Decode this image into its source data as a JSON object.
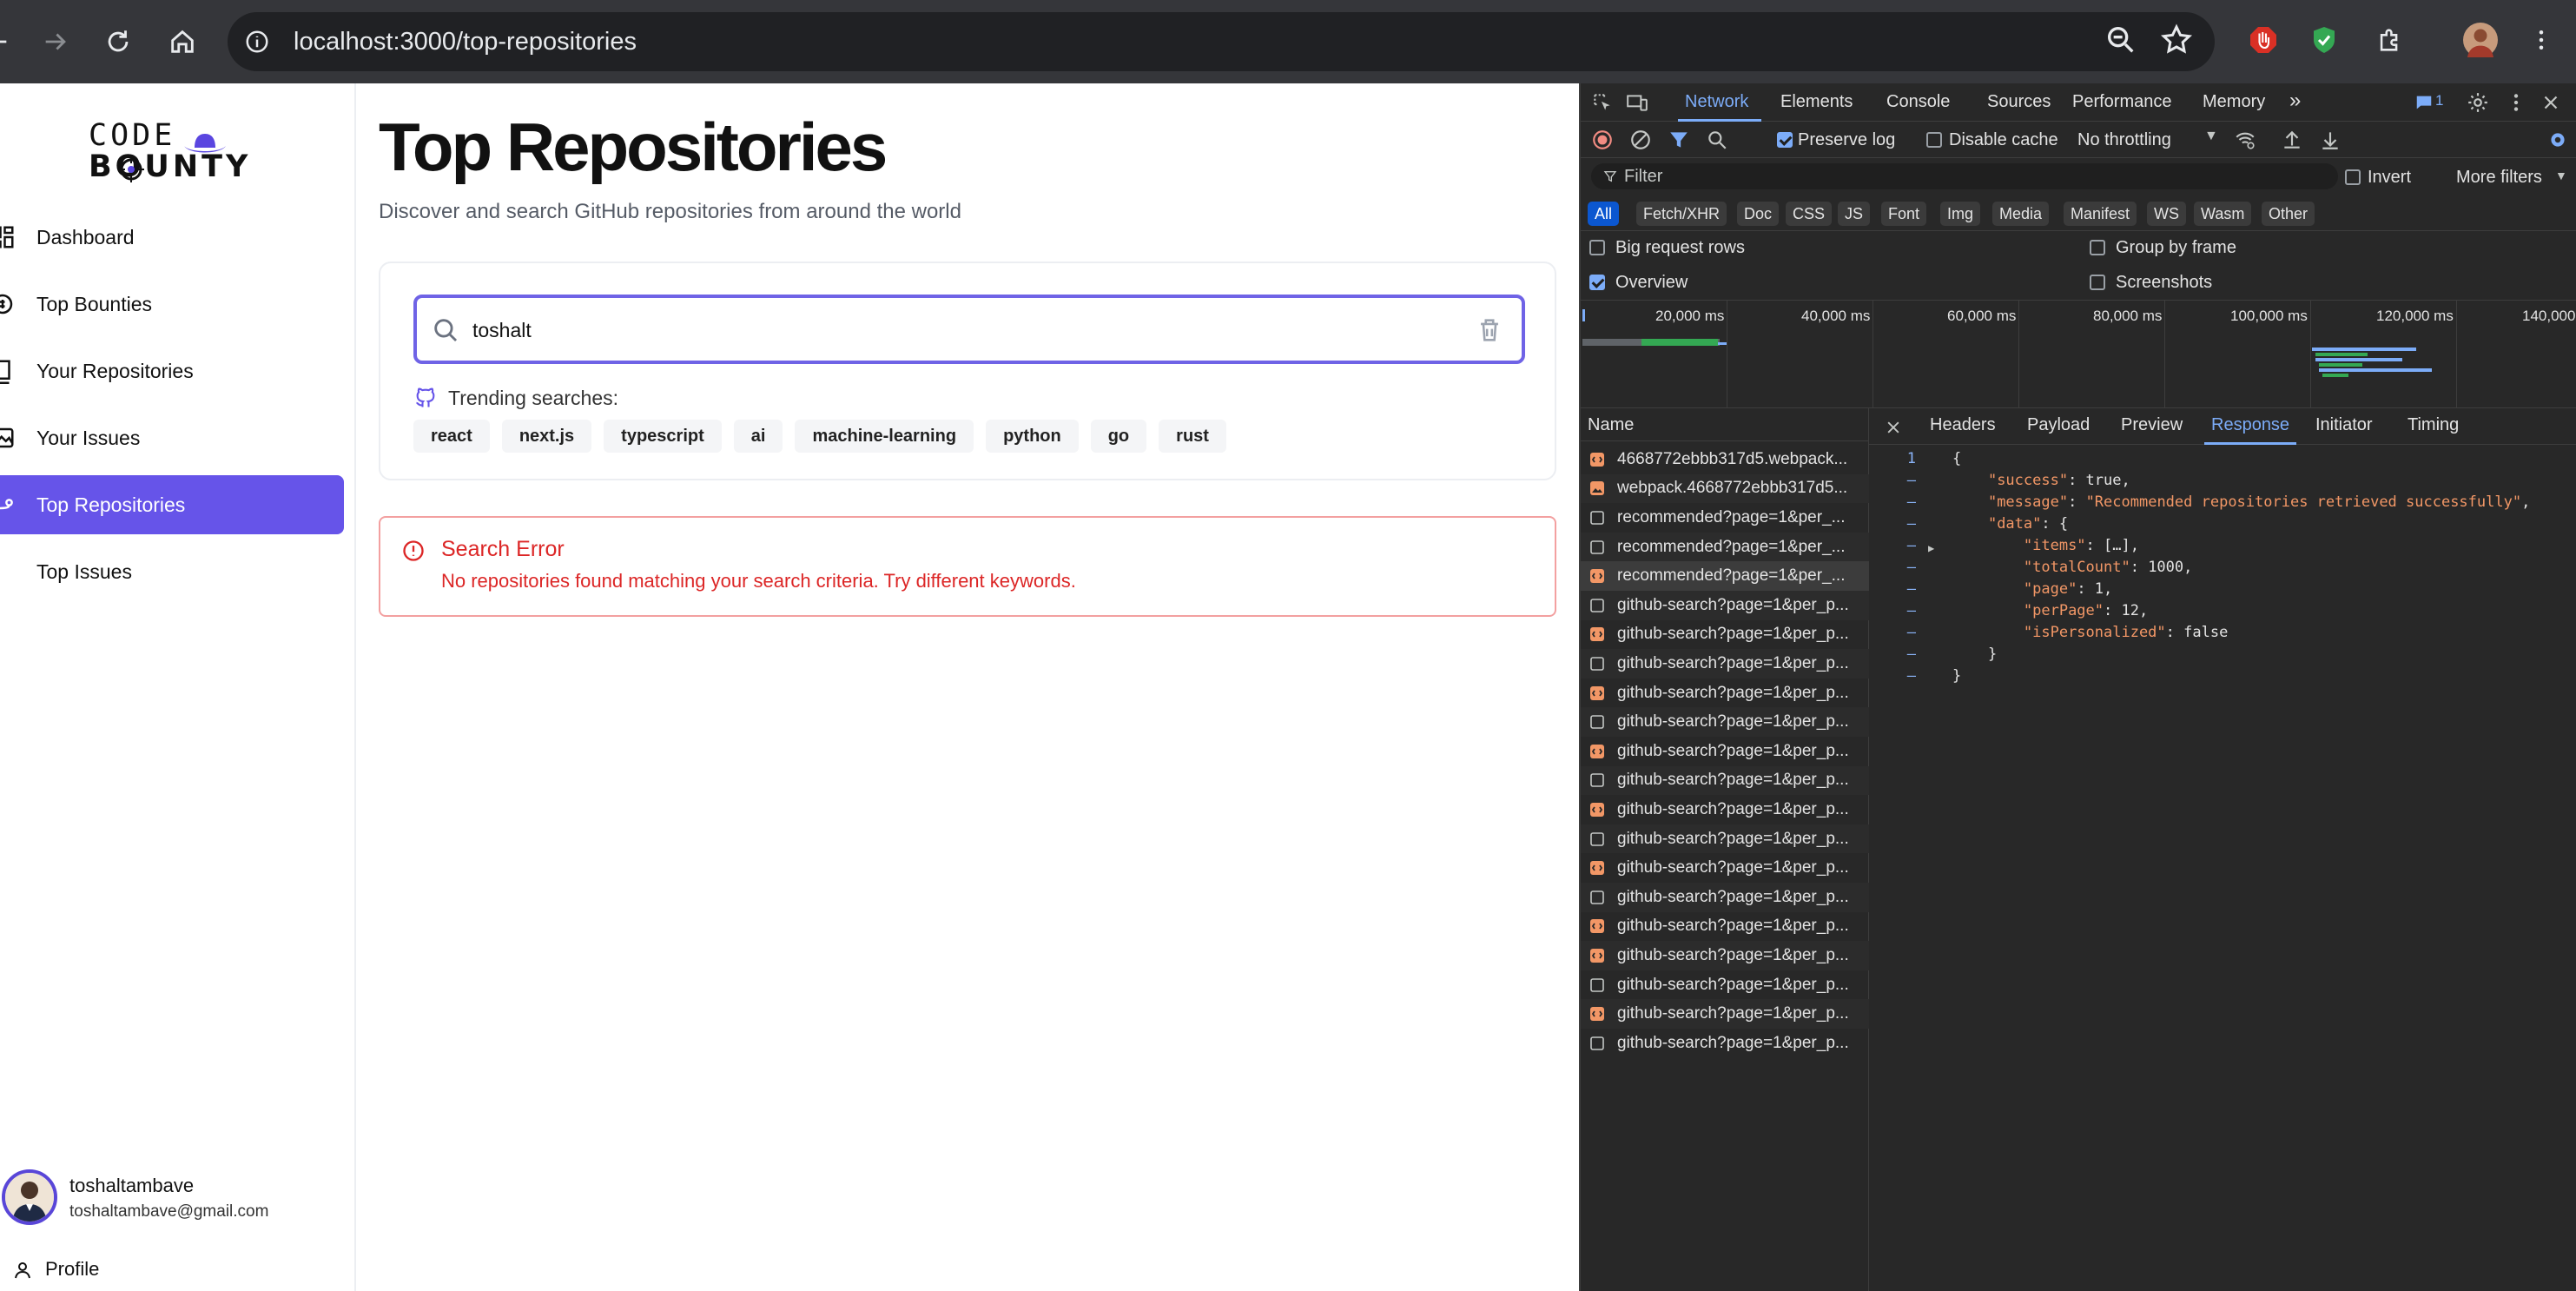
{
  "browser": {
    "url": "localhost:3000/top-repositories"
  },
  "sidebar": {
    "logo_line1": "CODE",
    "logo_line2": "BOUNTY",
    "items": [
      {
        "label": "Dashboard"
      },
      {
        "label": "Top Bounties"
      },
      {
        "label": "Your Repositories"
      },
      {
        "label": "Your Issues"
      },
      {
        "label": "Top Repositories"
      },
      {
        "label": "Top Issues"
      }
    ],
    "user_name": "toshaltambave",
    "user_email": "toshaltambave@gmail.com",
    "profile_label": "Profile"
  },
  "main": {
    "title": "Top Repositories",
    "subtitle": "Discover and search GitHub repositories from around the world",
    "search_value": "toshalt",
    "trending_label": "Trending searches:",
    "tags": [
      "react",
      "next.js",
      "typescript",
      "ai",
      "machine-learning",
      "python",
      "go",
      "rust"
    ],
    "error_title": "Search Error",
    "error_message": "No repositories found matching your search criteria. Try different keywords."
  },
  "devtools": {
    "tabs": [
      "Network",
      "Elements",
      "Console",
      "Sources",
      "Performance",
      "Memory"
    ],
    "issues_count": "1",
    "preserve_log": "Preserve log",
    "disable_cache": "Disable cache",
    "throttling": "No throttling",
    "filter_placeholder": "Filter",
    "invert": "Invert",
    "more_filters": "More filters",
    "types": [
      "All",
      "Fetch/XHR",
      "Doc",
      "CSS",
      "JS",
      "Font",
      "Img",
      "Media",
      "Manifest",
      "WS",
      "Wasm",
      "Other"
    ],
    "options": {
      "big_request_rows": "Big request rows",
      "group_by_frame": "Group by frame",
      "overview": "Overview",
      "screenshots": "Screenshots"
    },
    "timeline_labels": [
      "20,000 ms",
      "40,000 ms",
      "60,000 ms",
      "80,000 ms",
      "100,000 ms",
      "120,000 ms",
      "140,000"
    ],
    "name_header": "Name",
    "requests": [
      {
        "name": "4668772ebbb317d5.webpack...",
        "kind": "script"
      },
      {
        "name": "webpack.4668772ebbb317d5...",
        "kind": "image"
      },
      {
        "name": "recommended?page=1&per_...",
        "kind": "doc"
      },
      {
        "name": "recommended?page=1&per_...",
        "kind": "doc"
      },
      {
        "name": "recommended?page=1&per_...",
        "kind": "script"
      },
      {
        "name": "github-search?page=1&per_p...",
        "kind": "doc"
      },
      {
        "name": "github-search?page=1&per_p...",
        "kind": "script"
      },
      {
        "name": "github-search?page=1&per_p...",
        "kind": "doc"
      },
      {
        "name": "github-search?page=1&per_p...",
        "kind": "script"
      },
      {
        "name": "github-search?page=1&per_p...",
        "kind": "doc"
      },
      {
        "name": "github-search?page=1&per_p...",
        "kind": "script"
      },
      {
        "name": "github-search?page=1&per_p...",
        "kind": "doc"
      },
      {
        "name": "github-search?page=1&per_p...",
        "kind": "script"
      },
      {
        "name": "github-search?page=1&per_p...",
        "kind": "doc"
      },
      {
        "name": "github-search?page=1&per_p...",
        "kind": "script"
      },
      {
        "name": "github-search?page=1&per_p...",
        "kind": "doc"
      },
      {
        "name": "github-search?page=1&per_p...",
        "kind": "script"
      },
      {
        "name": "github-search?page=1&per_p...",
        "kind": "script"
      },
      {
        "name": "github-search?page=1&per_p...",
        "kind": "doc"
      },
      {
        "name": "github-search?page=1&per_p...",
        "kind": "script"
      },
      {
        "name": "github-search?page=1&per_p...",
        "kind": "doc"
      }
    ],
    "detail_tabs": [
      "Headers",
      "Payload",
      "Preview",
      "Response",
      "Initiator",
      "Timing"
    ],
    "response_lines": [
      {
        "gutter": "1",
        "html": "{"
      },
      {
        "gutter": "–",
        "html": "    <span class=\"k\">\"success\"</span>: true,"
      },
      {
        "gutter": "–",
        "html": "    <span class=\"k\">\"message\"</span>: <span class=\"s\">\"Recommended repositories retrieved successfully\"</span>,"
      },
      {
        "gutter": "–",
        "html": "    <span class=\"k\">\"data\"</span>: {"
      },
      {
        "gutter": "–",
        "html": "        <span class=\"k\">\"items\"</span>: […],"
      },
      {
        "gutter": "–",
        "html": "        <span class=\"k\">\"totalCount\"</span>: 1000,"
      },
      {
        "gutter": "–",
        "html": "        <span class=\"k\">\"page\"</span>: 1,"
      },
      {
        "gutter": "–",
        "html": "        <span class=\"k\">\"perPage\"</span>: 12,"
      },
      {
        "gutter": "–",
        "html": "        <span class=\"k\">\"isPersonalized\"</span>: false"
      },
      {
        "gutter": "–",
        "html": "    }"
      },
      {
        "gutter": "–",
        "html": "}"
      }
    ]
  }
}
